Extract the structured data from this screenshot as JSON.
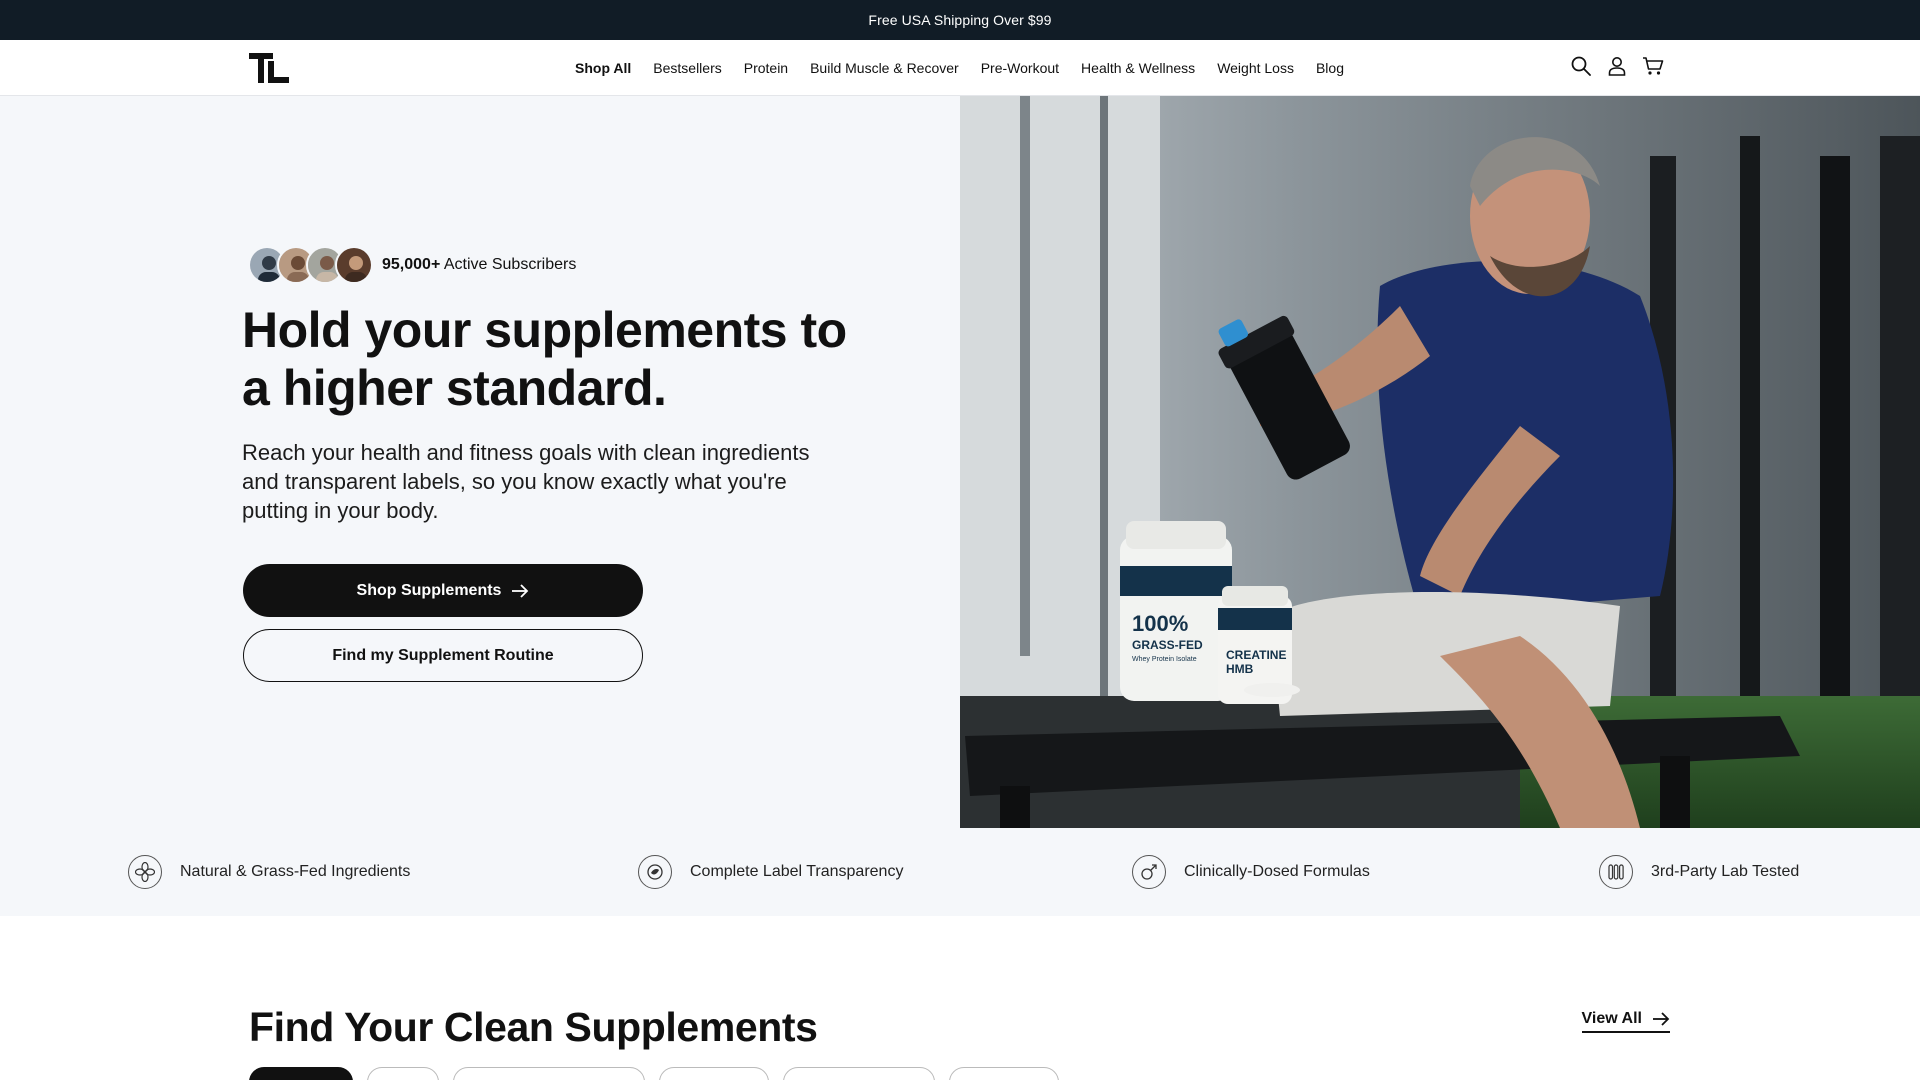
{
  "announcement": {
    "text": "Free USA Shipping Over $99"
  },
  "header": {
    "nav": [
      {
        "label": "Shop All",
        "active": true
      },
      {
        "label": "Bestsellers"
      },
      {
        "label": "Protein"
      },
      {
        "label": "Build Muscle & Recover"
      },
      {
        "label": "Pre-Workout"
      },
      {
        "label": "Health & Wellness"
      },
      {
        "label": "Weight Loss"
      },
      {
        "label": "Blog"
      }
    ],
    "icons": [
      "search-icon",
      "account-icon",
      "cart-icon"
    ]
  },
  "hero": {
    "subscribers_count": "95,000+",
    "subscribers_label": "Active Subscribers",
    "title": "Hold your supplements to a higher standard.",
    "subtitle": "Reach your health and fitness goals with clean ingredients and transparent labels, so you know exactly what you're putting in your body.",
    "primary_button": "Shop Supplements",
    "secondary_button": "Find my Supplement Routine",
    "image_products": {
      "whey_headline": "100% GRASS-FED",
      "whey_sub": "Whey Protein Isolate",
      "creatine_headline": "CREATINE HMB"
    }
  },
  "features": [
    {
      "label": "Natural & Grass-Fed Ingredients",
      "icon": "leaf-flower-icon"
    },
    {
      "label": "Complete Label Transparency",
      "icon": "label-icon"
    },
    {
      "label": "Clinically-Dosed Formulas",
      "icon": "dosage-icon"
    },
    {
      "label": "3rd-Party Lab Tested",
      "icon": "test-tubes-icon"
    }
  ],
  "find_section": {
    "title": "Find Your Clean Supplements",
    "view_all": "View All"
  },
  "colors": {
    "announce_bg": "#111c26",
    "hero_bg": "#f5f7fa",
    "primary": "#111111"
  }
}
